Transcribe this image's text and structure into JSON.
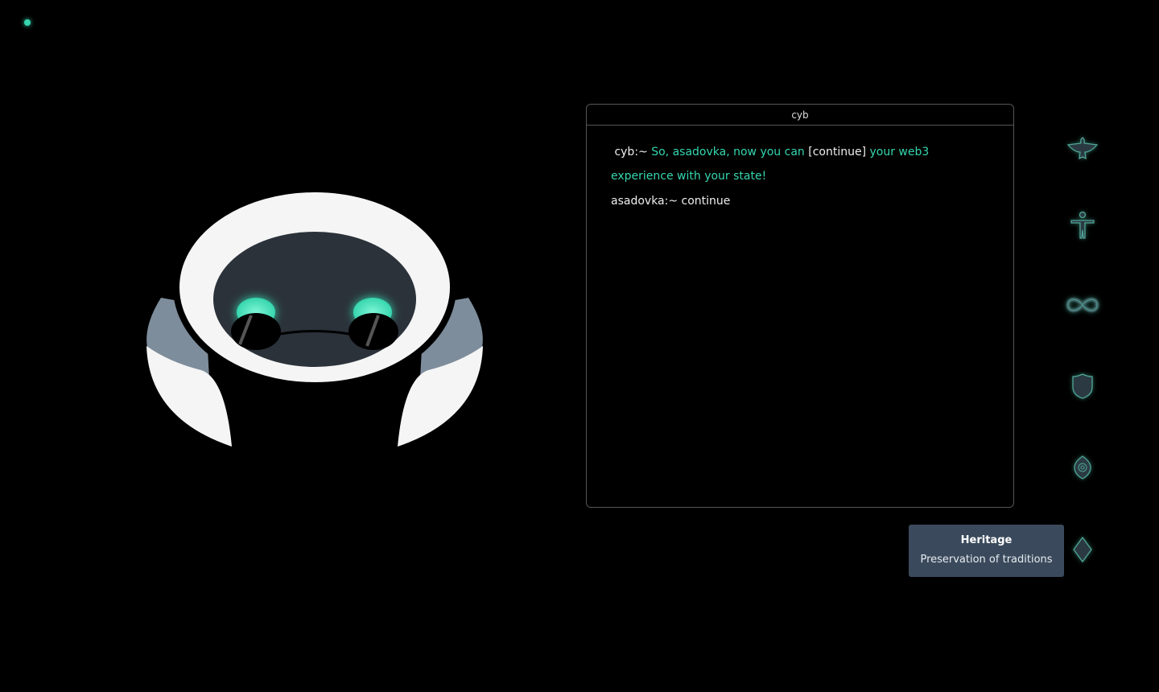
{
  "status_dot_color": "#36d6ae",
  "terminal": {
    "title": "cyb",
    "message": {
      "prompt": "cyb:~",
      "part1": "So, asadovka, now you can",
      "link": "[continue]",
      "part2": "your web3 experience with your state!"
    },
    "user_line": "asadovka:~ continue"
  },
  "sidebar": {
    "items": [
      {
        "icon": "bird-icon"
      },
      {
        "icon": "human-icon"
      },
      {
        "icon": "infinity-icon"
      },
      {
        "icon": "shield-icon"
      },
      {
        "icon": "eye-icon"
      },
      {
        "icon": "diamond-icon"
      }
    ]
  },
  "tooltip": {
    "title": "Heritage",
    "description": "Preservation of traditions"
  }
}
